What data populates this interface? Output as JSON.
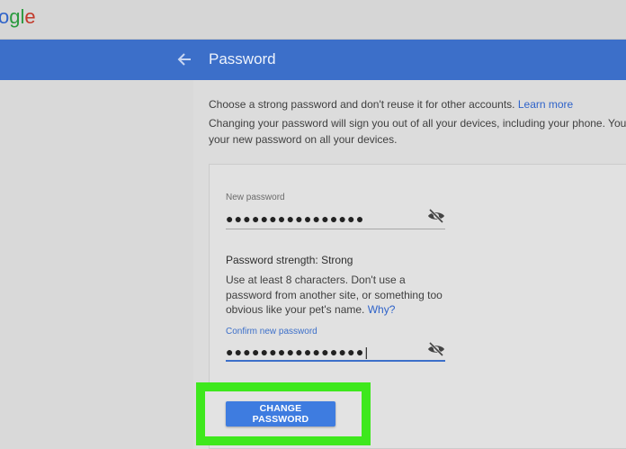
{
  "logo": {
    "part1": "o",
    "part2": "gl",
    "part3": "e"
  },
  "header": {
    "title": "Password",
    "back_icon": "arrow-left-icon"
  },
  "intro": {
    "line1_text": "Choose a strong password and don't reuse it for other accounts.",
    "line1_link": "Learn more",
    "line2": "Changing your password will sign you out of all your devices, including your phone. You will n",
    "line3": "your new password on all your devices."
  },
  "new_password": {
    "label": "New password",
    "value": "●●●●●●●●●●●●●●●●",
    "toggle_icon": "eye-off-icon"
  },
  "strength": {
    "label": "Password strength:",
    "value": "Strong"
  },
  "help": {
    "text": "Use at least 8 characters. Don't use a password from another site, or something too obvious like your pet's name.",
    "link": "Why?"
  },
  "confirm_password": {
    "label": "Confirm new password",
    "value": "●●●●●●●●●●●●●●●●|",
    "toggle_icon": "eye-off-icon"
  },
  "submit": {
    "label": "CHANGE PASSWORD"
  },
  "colors": {
    "header": "#3c6fc9",
    "accent": "#3e7ce0",
    "highlight": "#3ee81d"
  }
}
